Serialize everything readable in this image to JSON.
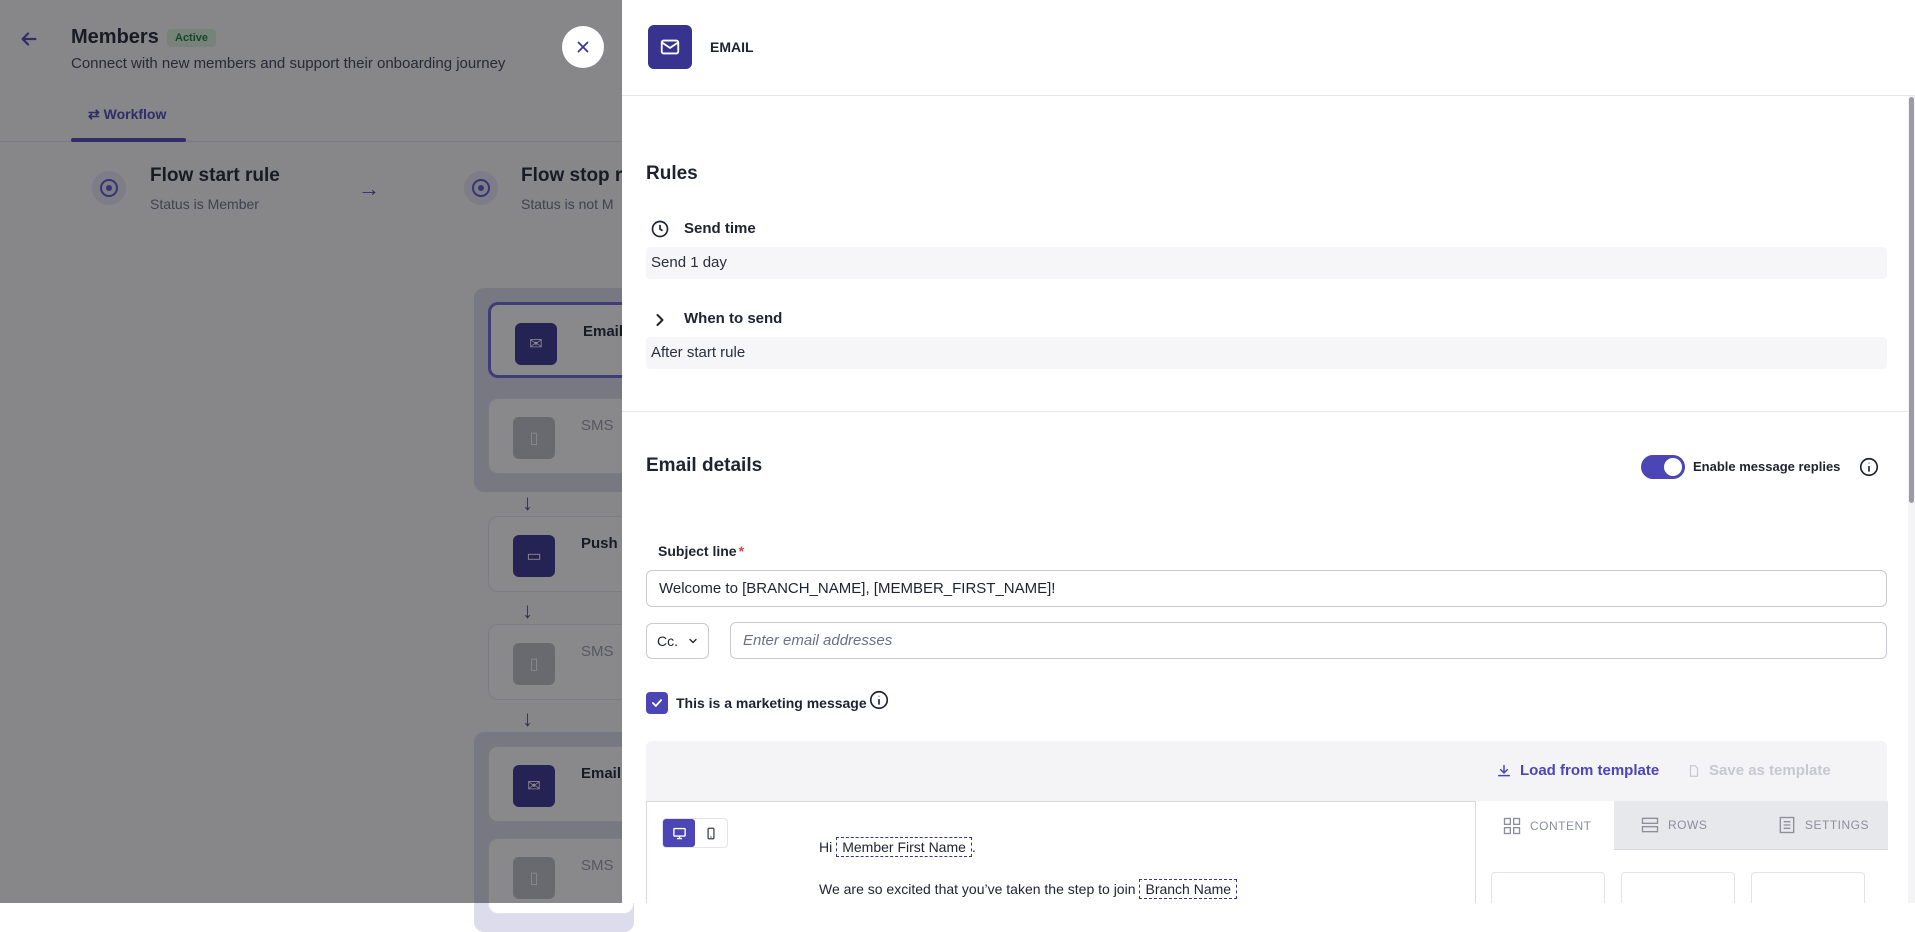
{
  "background": {
    "title": "Members",
    "badge": "Active",
    "subtitle": "Connect with new members and support their onboarding journey",
    "tab": "Workflow",
    "start_rule": {
      "title": "Flow start rule",
      "sub": "Status is Member"
    },
    "stop_rule": {
      "title": "Flow stop r",
      "sub": "Status is not M"
    },
    "cards": [
      {
        "label": "Email"
      },
      {
        "label": "SMS"
      },
      {
        "label": "Push"
      },
      {
        "label": "SMS"
      },
      {
        "label": "Email"
      },
      {
        "label": "SMS"
      }
    ]
  },
  "drawer": {
    "channel": "EMAIL",
    "rules": {
      "title": "Rules",
      "send_time_label": "Send time",
      "send_time_value": "Send 1 day",
      "when_label": "When to send",
      "when_value": "After start rule"
    },
    "email_details": {
      "title": "Email details",
      "toggle_label": "Enable message replies",
      "toggle_on": true,
      "subject_label": "Subject line",
      "required_mark": "*",
      "subject_value": "Welcome to [BRANCH_NAME], [MEMBER_FIRST_NAME]!",
      "cc_label": "Cc.",
      "cc_placeholder": "Enter email addresses",
      "marketing_label": "This is a marketing message",
      "marketing_checked": true
    },
    "editor": {
      "load_template": "Load from template",
      "save_template": "Save as template",
      "greeting": "Hi",
      "tag_first_name": "Member First Name",
      "greeting_end": ".",
      "body_start": "We are so excited that you’ve taken the step to join",
      "tag_branch": "Branch Name",
      "tabs": [
        "CONTENT",
        "ROWS",
        "SETTINGS"
      ]
    }
  },
  "colors": {
    "accent": "#4b45b6",
    "icon_bg": "#37338f",
    "required": "#d64545"
  }
}
